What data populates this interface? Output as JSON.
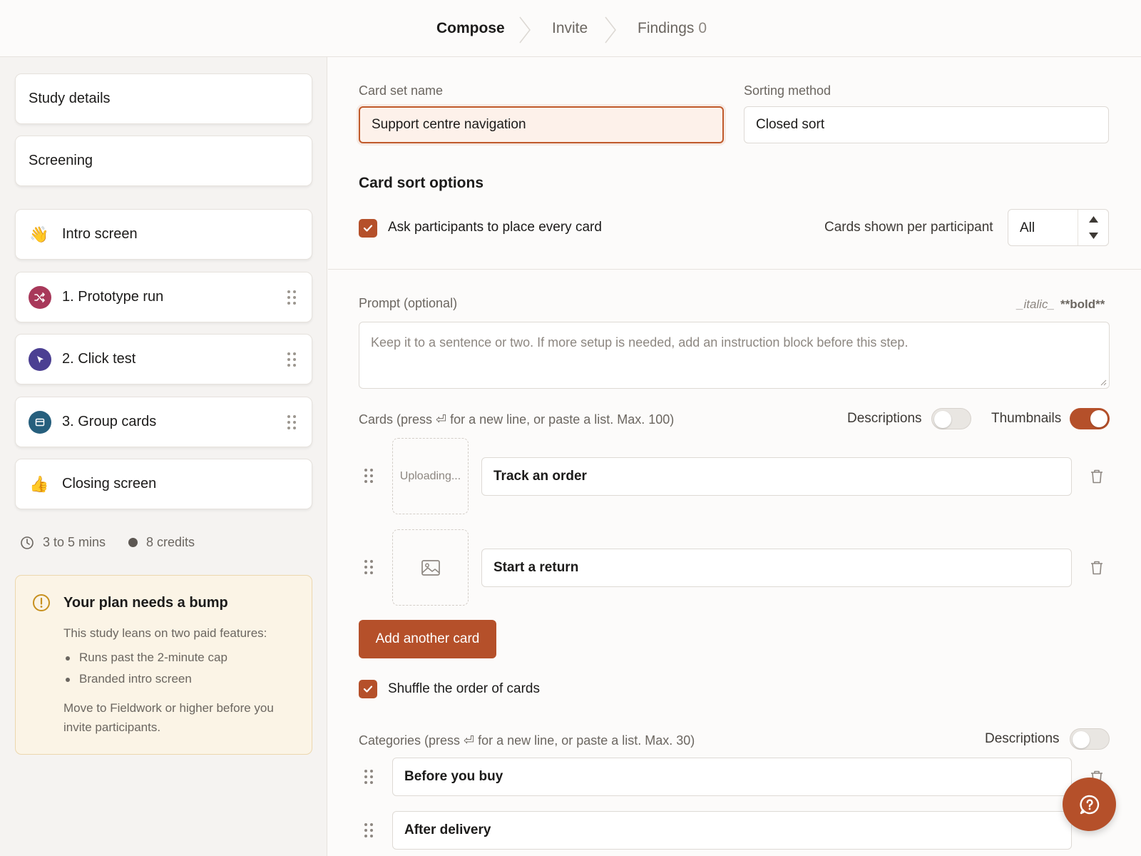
{
  "steps": [
    {
      "label": "Compose",
      "count": ""
    },
    {
      "label": "Invite",
      "count": ""
    },
    {
      "label": "Findings",
      "count": "0"
    }
  ],
  "sidebar": {
    "items": [
      {
        "label": "Study details"
      },
      {
        "label": "Screening"
      },
      {
        "label": "Intro screen",
        "icon": "waving-hand-icon",
        "glyph": "👋"
      },
      {
        "label": "1. Prototype run",
        "icon": "shuffle-icon",
        "color": "#a8385a"
      },
      {
        "label": "2. Click test",
        "icon": "cursor-icon",
        "color": "#4b3f92"
      },
      {
        "label": "3. Group cards",
        "icon": "cards-icon",
        "color": "#265f7d"
      },
      {
        "label": "Closing screen",
        "icon": "thumbs-up-icon",
        "glyph": "👍"
      }
    ],
    "duration": "3 to 5 mins",
    "credits": "8 credits",
    "upgrade": {
      "title": "Your plan needs a bump",
      "body": "This study leans on two paid features:",
      "features": [
        "Runs past the 2-minute cap",
        "Branded intro screen"
      ],
      "footer": "Move to Fieldwork or higher before you invite participants."
    }
  },
  "main": {
    "card_set_name": {
      "label": "Card set name",
      "value": "Support centre navigation"
    },
    "sorting_method": {
      "label": "Sorting method",
      "value": "Closed sort"
    },
    "options": {
      "title": "Card sort options",
      "place_every_card": {
        "label": "Ask participants to place every card",
        "checked": true
      },
      "per_participant": {
        "label": "Cards shown per participant",
        "value": "All"
      }
    },
    "prompt": {
      "label": "Prompt (optional)",
      "italic_hint": "_italic_",
      "bold_hint": "**bold**",
      "placeholder": "Keep it to a sentence or two. If more setup is needed, add an instruction block before this step."
    },
    "cards": {
      "label": "Cards (press ⏎ for a new line, or paste a list. Max. 100)",
      "descriptions_label": "Descriptions",
      "descriptions_on": false,
      "thumbnails_label": "Thumbnails",
      "thumbnails_on": true,
      "items": [
        {
          "label": "Track an order",
          "thumb": "Uploading..."
        },
        {
          "label": "Start a return",
          "thumb": ""
        }
      ],
      "add_button": "Add another card",
      "shuffle": {
        "label": "Shuffle the order of cards",
        "checked": true
      }
    },
    "categories": {
      "label": "Categories (press ⏎ for a new line, or paste a list. Max. 30)",
      "descriptions_label": "Descriptions",
      "descriptions_on": false,
      "items": [
        {
          "label": "Before you buy"
        },
        {
          "label": "After delivery"
        }
      ]
    }
  },
  "colors": {
    "accent": "#b5502a",
    "warning": "#c7901e"
  }
}
